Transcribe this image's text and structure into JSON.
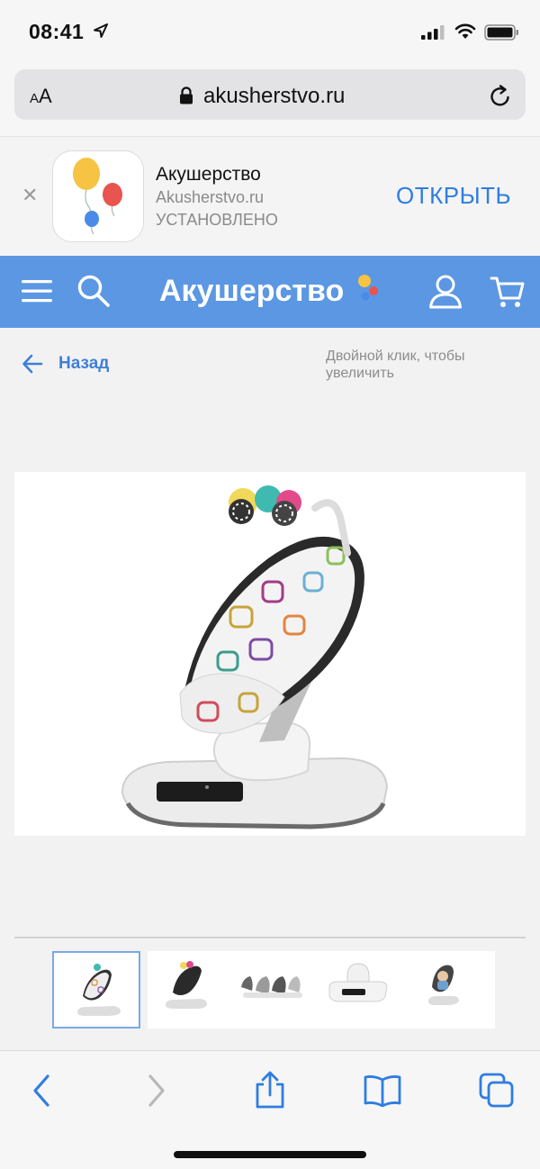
{
  "status_bar": {
    "time": "08:41"
  },
  "url_bar": {
    "text_size_label_small": "A",
    "text_size_label_large": "A",
    "domain": "akusherstvo.ru"
  },
  "app_banner": {
    "app_name": "Акушерство",
    "site": "Akusherstvo.ru",
    "status": "УСТАНОВЛЕНО",
    "open_label": "ОТКРЫТЬ"
  },
  "site_header": {
    "brand": "Акушерство",
    "accent_colors": [
      "#f6c343",
      "#e8544e",
      "#4a8ae8"
    ]
  },
  "gallery": {
    "back_label": "Назад",
    "zoom_hint": "Двойной клик, чтобы увеличить",
    "thumbnails": [
      {
        "label": "swing-front",
        "active": true
      },
      {
        "label": "swing-side",
        "active": false
      },
      {
        "label": "swing-colors",
        "active": false
      },
      {
        "label": "swing-base",
        "active": false
      },
      {
        "label": "swing-baby",
        "active": false
      }
    ]
  },
  "colors": {
    "header_blue": "#5b97e3",
    "link_blue": "#3f7fd6",
    "ios_blue": "#2f7de1"
  }
}
